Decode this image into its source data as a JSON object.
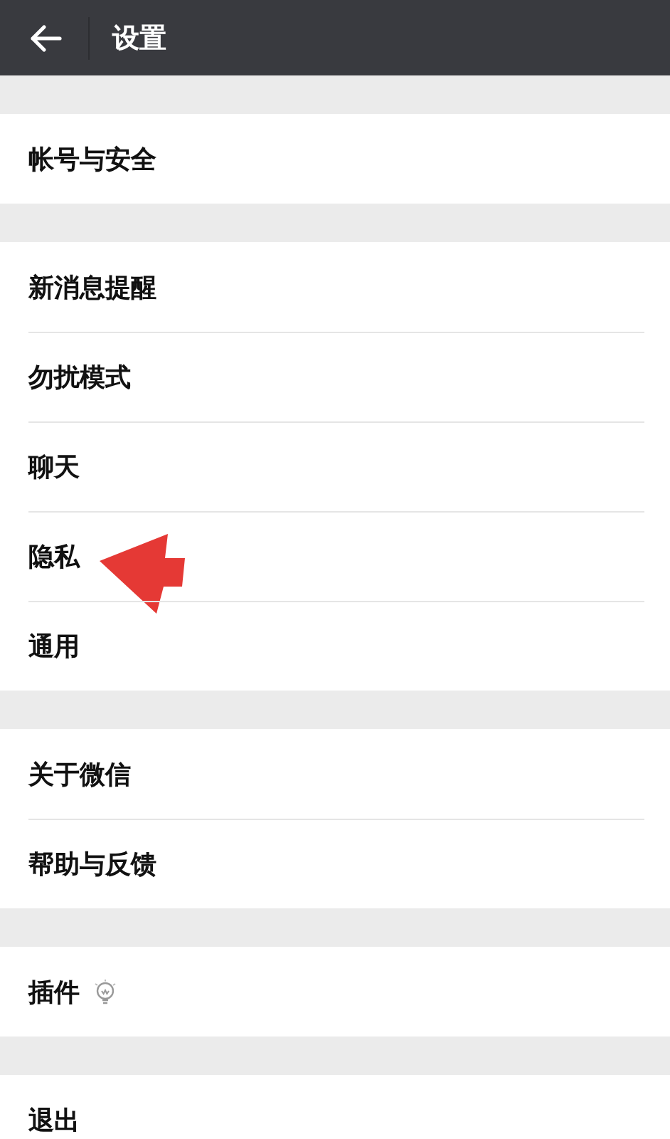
{
  "header": {
    "title": "设置"
  },
  "groups": [
    {
      "items": [
        {
          "label": "帐号与安全",
          "kind": "text",
          "pointed": false
        }
      ]
    },
    {
      "items": [
        {
          "label": "新消息提醒",
          "kind": "text",
          "pointed": false
        },
        {
          "label": "勿扰模式",
          "kind": "text",
          "pointed": false
        },
        {
          "label": "聊天",
          "kind": "text",
          "pointed": false
        },
        {
          "label": "隐私",
          "kind": "text",
          "pointed": true
        },
        {
          "label": "通用",
          "kind": "text",
          "pointed": false
        }
      ]
    },
    {
      "items": [
        {
          "label": "关于微信",
          "kind": "text",
          "pointed": false
        },
        {
          "label": "帮助与反馈",
          "kind": "text",
          "pointed": false
        }
      ]
    },
    {
      "items": [
        {
          "label": "插件",
          "kind": "plugin",
          "pointed": false
        }
      ]
    },
    {
      "items": [
        {
          "label": "退出",
          "kind": "text",
          "pointed": false
        }
      ]
    }
  ]
}
